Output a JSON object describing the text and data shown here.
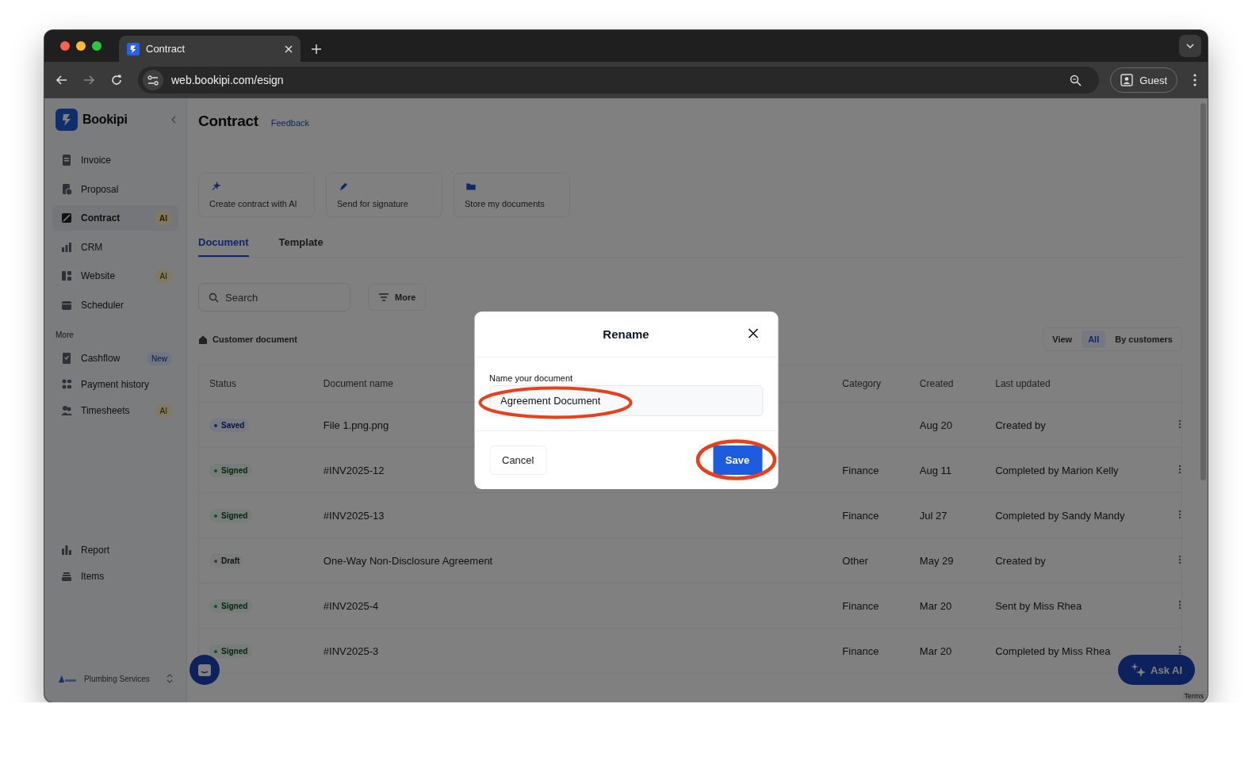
{
  "browser": {
    "tab_title": "Contract",
    "url": "web.bookipi.com/esign",
    "profile": "Guest"
  },
  "sidebar": {
    "brand": "Bookipi",
    "items": [
      {
        "label": "Invoice",
        "selected": false
      },
      {
        "label": "Proposal",
        "selected": false
      },
      {
        "label": "Contract",
        "selected": true,
        "badge": {
          "text": "AI",
          "kind": "ai"
        }
      },
      {
        "label": "CRM",
        "selected": false
      },
      {
        "label": "Website",
        "selected": false,
        "badge": {
          "text": "AI",
          "kind": "ai"
        }
      },
      {
        "label": "Scheduler",
        "selected": false
      }
    ],
    "section_label": "More",
    "more_items": [
      {
        "label": "Cashflow",
        "selected": false,
        "badge": {
          "text": "New",
          "kind": "new"
        }
      },
      {
        "label": "Payment history",
        "selected": false
      },
      {
        "label": "Timesheets",
        "selected": false,
        "badge": {
          "text": "AI",
          "kind": "ai"
        }
      }
    ],
    "bottom_items": [
      {
        "label": "Report",
        "selected": false
      },
      {
        "label": "Items",
        "selected": false
      }
    ],
    "workspace": "Plumbing Services"
  },
  "main": {
    "title": "Contract",
    "feedback": "Feedback",
    "cards": [
      "Create contract with AI",
      "Send for signature",
      "Store my documents"
    ],
    "tabs": [
      {
        "label": "Document",
        "selected": true
      },
      {
        "label": "Template",
        "selected": false
      }
    ],
    "search": {
      "placeholder": "Search"
    },
    "more_button": "More",
    "section": "Customer document",
    "view_label": "View",
    "view_options": [
      {
        "label": "All",
        "selected": true
      },
      {
        "label": "By customers",
        "selected": false
      }
    ],
    "table": {
      "columns": [
        "Status",
        "Document name",
        "Category",
        "Created",
        "Last updated"
      ],
      "rows": [
        {
          "status": {
            "text": "Saved",
            "kind": "saved"
          },
          "name": "File 1.png.png",
          "created": "Aug 20",
          "updated": "Created by"
        },
        {
          "status": {
            "text": "Signed",
            "kind": "signed"
          },
          "name": "#INV2025-12",
          "category": "Finance",
          "created": "Aug 11",
          "updated": "Completed by Marion Kelly"
        },
        {
          "status": {
            "text": "Signed",
            "kind": "signed"
          },
          "name": "#INV2025-13",
          "category": "Finance",
          "created": "Jul 27",
          "updated": "Completed by Sandy Mandy"
        },
        {
          "status": {
            "text": "Draft",
            "kind": "draft"
          },
          "name": "One-Way Non-Disclosure Agreement",
          "category": "Other",
          "created": "May 29",
          "updated": "Created by"
        },
        {
          "status": {
            "text": "Signed",
            "kind": "signed"
          },
          "name": "#INV2025-4",
          "category": "Finance",
          "created": "Mar 20",
          "updated": "Sent by Miss Rhea"
        },
        {
          "status": {
            "text": "Signed",
            "kind": "signed"
          },
          "name": "#INV2025-3",
          "category": "Finance",
          "created": "Mar 20",
          "updated": "Completed by Miss Rhea"
        }
      ]
    },
    "ask_ai": "Ask AI",
    "recaptcha": "Terms"
  },
  "modal": {
    "title": "Rename",
    "field_label": "Name your document",
    "field_value": "Agreement Document",
    "field_circled": true,
    "cancel": "Cancel",
    "save": "Save",
    "save_circled": true
  }
}
